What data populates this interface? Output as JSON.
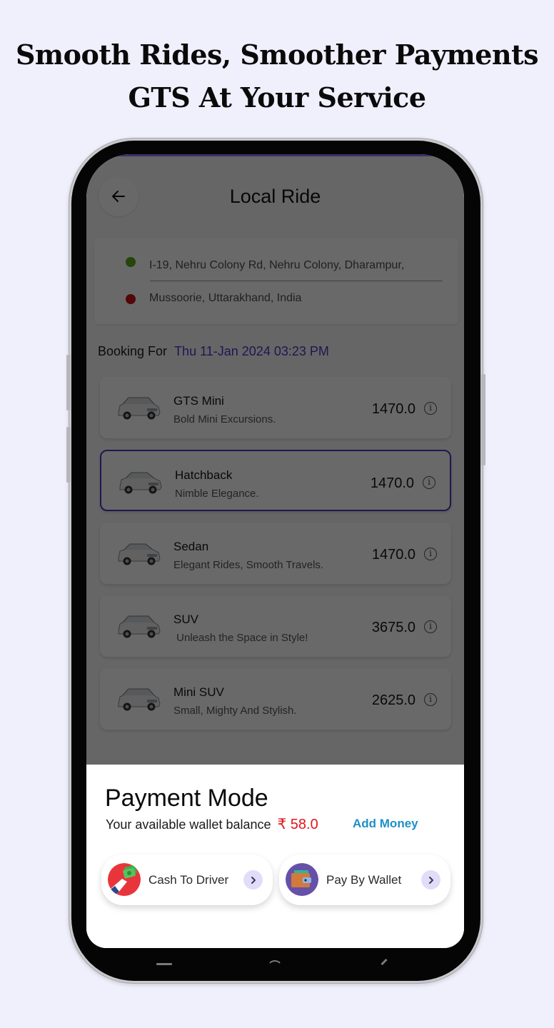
{
  "promo": {
    "headline_line1": "Smooth Rides, Smoother Payments",
    "headline_line2": "GTS At Your Service"
  },
  "app": {
    "title": "Local Ride",
    "back_icon": "arrow-left-icon",
    "pickup": {
      "address": "I-19, Nehru Colony Rd, Nehru Colony, Dharampur,",
      "dot_color": "#5aa51a"
    },
    "drop": {
      "address": "Mussoorie, Uttarakhand, India",
      "dot_color": "#c4121a"
    },
    "booking": {
      "label": "Booking For",
      "datetime": "Thu 11-Jan 2024 03:23 PM"
    },
    "rides": [
      {
        "name": "GTS Mini",
        "description": "Bold Mini Excursions.",
        "price": "1470.0",
        "selected": false,
        "icon": "mpv-car-icon"
      },
      {
        "name": "Hatchback",
        "description": "Nimble Elegance.",
        "price": "1470.0",
        "selected": true,
        "icon": "hatchback-car-icon"
      },
      {
        "name": "Sedan",
        "description": "Elegant Rides, Smooth Travels.",
        "price": "1470.0",
        "selected": false,
        "icon": "sedan-car-icon"
      },
      {
        "name": "SUV",
        "description": " Unleash the Space in Style!",
        "price": "3675.0",
        "selected": false,
        "icon": "suv-car-icon"
      },
      {
        "name": "Mini SUV",
        "description": "Small, Mighty And Stylish.",
        "price": "2625.0",
        "selected": false,
        "icon": "mini-suv-car-icon"
      }
    ],
    "info_glyph": "i"
  },
  "payment": {
    "title": "Payment Mode",
    "wallet_label": "Your available wallet balance",
    "wallet_amount": "₹ 58.0",
    "add_money": "Add Money",
    "options": [
      {
        "label": "Cash To Driver",
        "icon": "cash-hand-icon"
      },
      {
        "label": "Pay By Wallet",
        "icon": "wallet-icon"
      }
    ],
    "chevron_glyph": "›"
  },
  "colors": {
    "background": "#f0effc",
    "accent": "#4a36c8",
    "add_money": "#1e90c7",
    "wallet_amount": "#e0151b",
    "chevron_bg": "#e2dcfb"
  }
}
